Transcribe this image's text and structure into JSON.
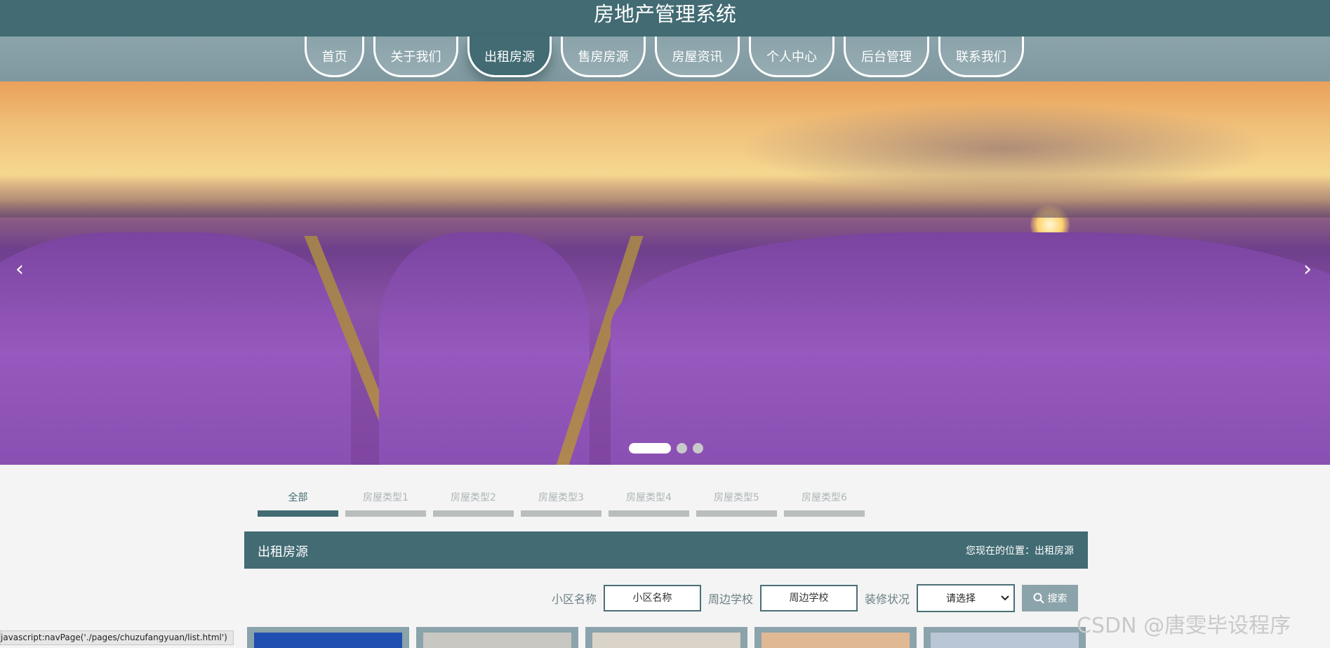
{
  "header": {
    "title": "房地产管理系统"
  },
  "nav": {
    "items": [
      {
        "label": "首页",
        "active": false
      },
      {
        "label": "关于我们",
        "active": false
      },
      {
        "label": "出租房源",
        "active": true
      },
      {
        "label": "售房房源",
        "active": false
      },
      {
        "label": "房屋资讯",
        "active": false
      },
      {
        "label": "个人中心",
        "active": false
      },
      {
        "label": "后台管理",
        "active": false
      },
      {
        "label": "联系我们",
        "active": false
      }
    ]
  },
  "carousel": {
    "prev_icon": "‹",
    "next_icon": "›",
    "slides": 3,
    "active_index": 0
  },
  "tabs": [
    "全部",
    "房屋类型1",
    "房屋类型2",
    "房屋类型3",
    "房屋类型4",
    "房屋类型5",
    "房屋类型6"
  ],
  "section": {
    "title": "出租房源",
    "breadcrumb": "您现在的位置：出租房源"
  },
  "search": {
    "community_label": "小区名称",
    "community_placeholder": "小区名称",
    "school_label": "周边学校",
    "school_placeholder": "周边学校",
    "decoration_label": "装修状况",
    "decoration_value": "请选择",
    "button_label": "搜索"
  },
  "status_bar": "javascript:navPage('./pages/chuzufangyuan/list.html')",
  "watermark": "CSDN @唐雯毕设程序",
  "colors": {
    "primary": "#426b73",
    "nav": "#8ba3aa",
    "background": "#f4f4f4"
  }
}
